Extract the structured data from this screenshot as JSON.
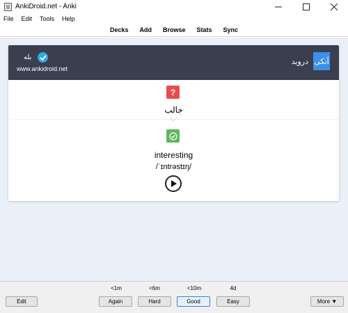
{
  "window": {
    "title": "AnkiDroid.net - Anki",
    "minimize": "—",
    "maximize": "☐",
    "close": "✕"
  },
  "menu": [
    "File",
    "Edit",
    "Tools",
    "Help"
  ],
  "toolbar": [
    "Decks",
    "Add",
    "Browse",
    "Stats",
    "Sync"
  ],
  "card": {
    "banner": {
      "logo": "آنکی",
      "logo_text": "درويد",
      "yes": "بله",
      "url": "www.ankidroid.net"
    },
    "question_icon": "?",
    "question": "جالب",
    "answer": "interesting",
    "ipa": "/ˈɪntrəstɪŋ/"
  },
  "bottom": {
    "edit": "Edit",
    "times": [
      "<1m",
      "<6m",
      "<10m",
      "4d"
    ],
    "answers": [
      "Again",
      "Hard",
      "Good",
      "Easy"
    ],
    "more": "More ▼"
  },
  "colors": {
    "banner_bg": "#3a3e4e",
    "question_icon": "#e84c4c",
    "answer_icon": "#5cb85c",
    "logo": "#3d8fe8",
    "check": "#35a8e0",
    "content_bg": "#eaf0f7"
  },
  "icons": {
    "app": "anki-app-icon",
    "check": "check-circle-icon",
    "question": "question-mark-icon",
    "answer": "check-icon",
    "play": "play-icon",
    "divider": "chevron-down-icon"
  }
}
